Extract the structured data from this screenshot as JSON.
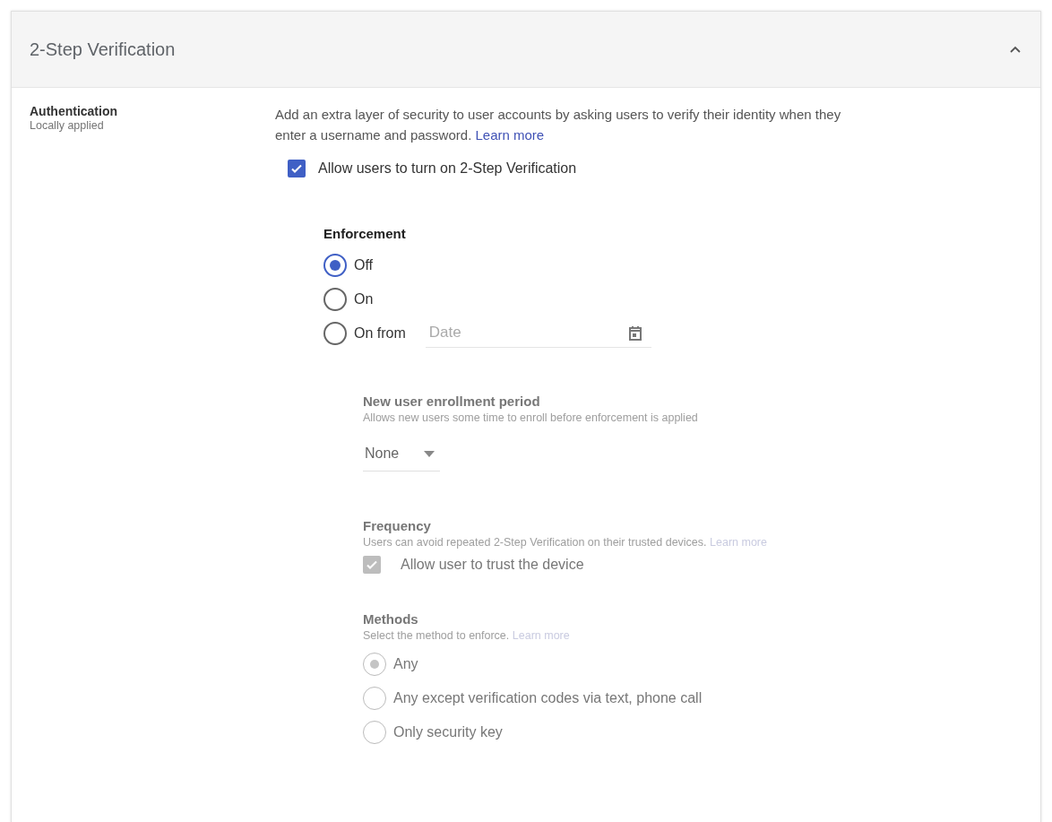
{
  "panel": {
    "title": "2-Step Verification",
    "expanded": true
  },
  "setting": {
    "name": "Authentication",
    "scope": "Locally applied"
  },
  "description": {
    "text": "Add an extra layer of security to user accounts by asking users to verify their identity when they enter a username and password.",
    "link": "Learn more"
  },
  "allow_checkbox": {
    "label": "Allow users to turn on 2-Step Verification",
    "checked": true,
    "disabled": false
  },
  "enforcement": {
    "heading": "Enforcement",
    "options": [
      {
        "label": "Off",
        "selected": true,
        "kind": "plain"
      },
      {
        "label": "On",
        "selected": false,
        "kind": "plain"
      },
      {
        "label": "On from",
        "selected": false,
        "kind": "date",
        "placeholder": "Date"
      }
    ]
  },
  "enrollment": {
    "heading": "New user enrollment period",
    "hint": "Allows new users some time to enroll before enforcement is applied",
    "value": "None",
    "disabled": true
  },
  "frequency": {
    "heading": "Frequency",
    "hint": "Users can avoid repeated 2-Step Verification on their trusted devices.",
    "link": "Learn more",
    "checkbox": {
      "label": "Allow user to trust the device",
      "checked": true,
      "disabled": true
    }
  },
  "methods": {
    "heading": "Methods",
    "hint": "Select the method to enforce.",
    "link": "Learn more",
    "disabled": true,
    "options": [
      {
        "label": "Any",
        "selected": true
      },
      {
        "label": "Any except verification codes via text, phone call",
        "selected": false
      },
      {
        "label": "Only security key",
        "selected": false
      }
    ]
  }
}
